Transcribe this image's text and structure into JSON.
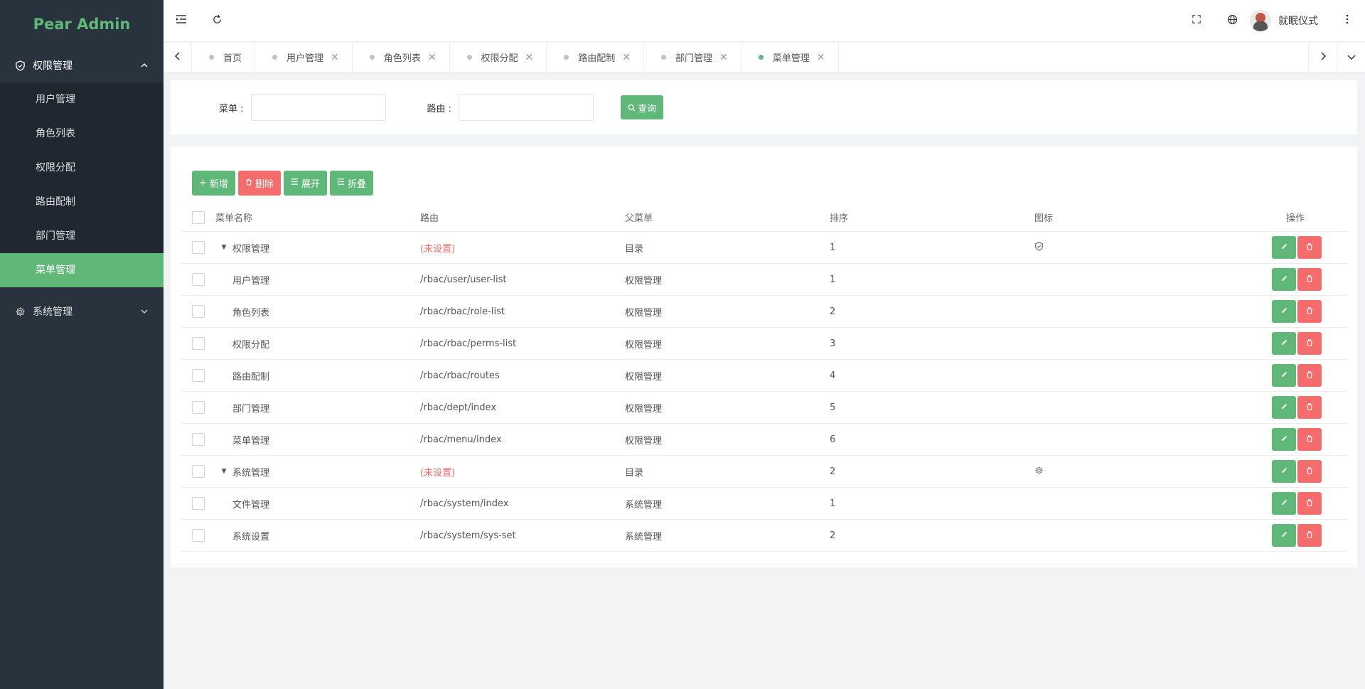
{
  "app": {
    "title": "Pear Admin"
  },
  "sidebar": {
    "groups": [
      {
        "label": "权限管理",
        "icon": "shield-icon",
        "open": true,
        "items": [
          {
            "label": "用户管理"
          },
          {
            "label": "角色列表"
          },
          {
            "label": "权限分配"
          },
          {
            "label": "路由配制"
          },
          {
            "label": "部门管理"
          },
          {
            "label": "菜单管理",
            "active": true
          }
        ]
      },
      {
        "label": "系统管理",
        "icon": "gear-icon",
        "open": false
      }
    ]
  },
  "header": {
    "username": "就眠仪式"
  },
  "tabs": [
    {
      "label": "首页"
    },
    {
      "label": "用户管理"
    },
    {
      "label": "角色列表"
    },
    {
      "label": "权限分配"
    },
    {
      "label": "路由配制"
    },
    {
      "label": "部门管理"
    },
    {
      "label": "菜单管理",
      "active": true
    }
  ],
  "search": {
    "menu_label": "菜单 :",
    "route_label": "路由 :",
    "menu_value": "",
    "route_value": "",
    "query_label": "查询"
  },
  "toolbar": {
    "add_label": "新增",
    "delete_label": "删除",
    "expand_label": "展开",
    "collapse_label": "折叠"
  },
  "table": {
    "columns": [
      "菜单名称",
      "路由",
      "父菜单",
      "排序",
      "图标",
      "操作"
    ],
    "rows": [
      {
        "name": "权限管理",
        "route": "(未设置)",
        "parent": "目录",
        "order": "1",
        "icon": "shield-icon",
        "folder": true
      },
      {
        "name": "用户管理",
        "route": "/rbac/user/user-list",
        "parent": "权限管理",
        "order": "1"
      },
      {
        "name": "角色列表",
        "route": "/rbac/rbac/role-list",
        "parent": "权限管理",
        "order": "2"
      },
      {
        "name": "权限分配",
        "route": "/rbac/rbac/perms-list",
        "parent": "权限管理",
        "order": "3"
      },
      {
        "name": "路由配制",
        "route": "/rbac/rbac/routes",
        "parent": "权限管理",
        "order": "4"
      },
      {
        "name": "部门管理",
        "route": "/rbac/dept/index",
        "parent": "权限管理",
        "order": "5"
      },
      {
        "name": "菜单管理",
        "route": "/rbac/menu/index",
        "parent": "权限管理",
        "order": "6"
      },
      {
        "name": "系统管理",
        "route": "(未设置)",
        "parent": "目录",
        "order": "2",
        "icon": "gear-icon",
        "folder": true
      },
      {
        "name": "文件管理",
        "route": "/rbac/system/index",
        "parent": "系统管理",
        "order": "1"
      },
      {
        "name": "系统设置",
        "route": "/rbac/system/sys-set",
        "parent": "系统管理",
        "order": "2"
      }
    ]
  },
  "colors": {
    "accent": "#5fb878",
    "danger": "#f56c6c",
    "sidebar": "#28333e",
    "sidebar_sub": "#1f2731"
  }
}
